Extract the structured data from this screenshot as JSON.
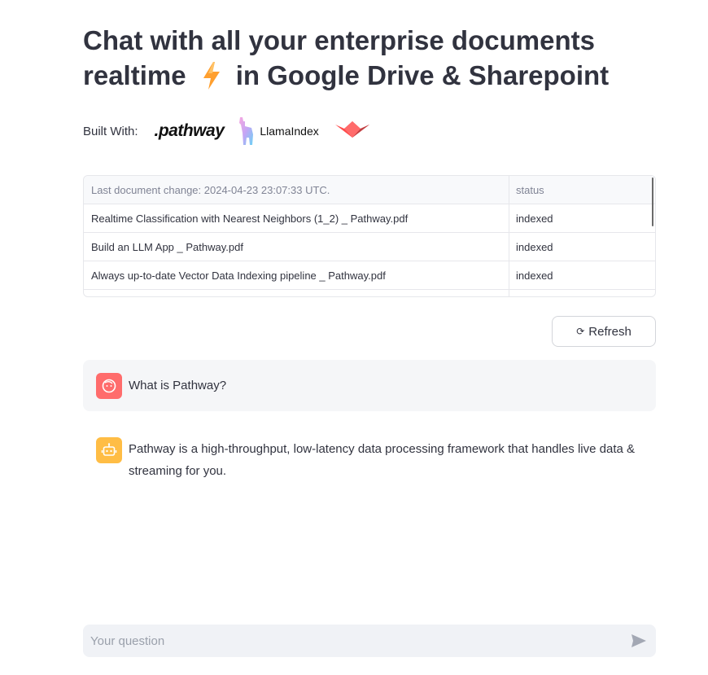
{
  "header": {
    "title_part1": "Chat with all your enterprise documents realtime",
    "title_part2": "in Google Drive & Sharepoint",
    "built_with_label": "Built With:",
    "logos": {
      "pathway": ".pathway",
      "llamaindex": "LlamaIndex"
    }
  },
  "table": {
    "columns": [
      "Last document change: 2024-04-23 23:07:33 UTC.",
      "status"
    ],
    "rows": [
      [
        "Realtime Classification with Nearest Neighbors (1_2) _ Pathway.pdf",
        "indexed"
      ],
      [
        "Build an LLM App _ Pathway.pdf",
        "indexed"
      ],
      [
        "Always up-to-date Vector Data Indexing pipeline _ Pathway.pdf",
        "indexed"
      ]
    ]
  },
  "refresh_button": {
    "label": "Refresh",
    "icon": "refresh-icon"
  },
  "chat": {
    "messages": [
      {
        "role": "user",
        "avatar_icon": "user-face-icon",
        "text": "What is Pathway?"
      },
      {
        "role": "assistant",
        "avatar_icon": "bot-icon",
        "text": "Pathway is a high-throughput, low-latency data processing framework that handles live data & streaming for you."
      }
    ],
    "input": {
      "placeholder": "Your question",
      "value": "",
      "send_icon": "send-icon"
    }
  },
  "colors": {
    "user_avatar": "#ff6c6c",
    "bot_avatar": "#ffbd45",
    "streamlit_logo": "#ff4b4b",
    "bolt": "#ff9f2e"
  }
}
